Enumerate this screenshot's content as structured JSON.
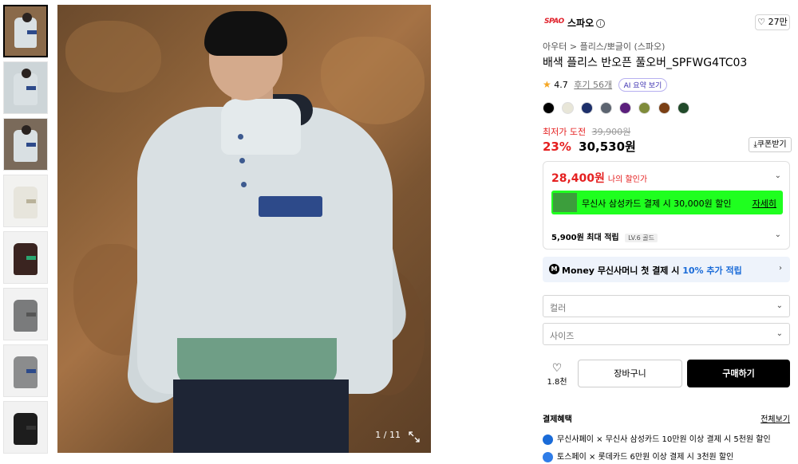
{
  "gallery": {
    "counter": "1 / 11",
    "thumbnails": [
      {
        "bg": "#8a6a4a",
        "garment": "#d9e0e3",
        "pocket": "#2d4a8a"
      },
      {
        "bg": "#cdd5d8",
        "garment": "#d9e0e3",
        "pocket": "#2d4a8a"
      },
      {
        "bg": "#7a6a5a",
        "garment": "#d9e0e3",
        "pocket": "#2d4a8a"
      },
      {
        "bg": "#f2f2f0",
        "garment": "#e7e5dc",
        "pocket": "#b9b29a"
      },
      {
        "bg": "#f2f2f2",
        "garment": "#3a2420",
        "pocket": "#2aa570"
      },
      {
        "bg": "#f2f2f2",
        "garment": "#7a7b7c",
        "pocket": "#555"
      },
      {
        "bg": "#f2f2f2",
        "garment": "#8b8c8d",
        "pocket": "#2d4a8a"
      },
      {
        "bg": "#f2f2f2",
        "garment": "#1d1d1d",
        "pocket": "#333"
      }
    ]
  },
  "brand": {
    "logo": "SPAO",
    "name": "스파오",
    "likes": "27만"
  },
  "breadcrumb": "아우터 > 플리스/뽀글이 (스파오)",
  "title": "배색 플리스 반오픈 풀오버_SPFWG4TC03",
  "rating": {
    "score": "4.7",
    "reviews": "후기 56개",
    "ai_label": "AI 요약 보기"
  },
  "colors": [
    "#000000",
    "#e8e6d8",
    "#1d2f6a",
    "#5c6470",
    "#5b1f7c",
    "#7f8b3a",
    "#7a3f14",
    "#214a2a"
  ],
  "pricing": {
    "deal_label": "최저가 도전",
    "original": "39,900원",
    "discount": "23%",
    "price": "30,530원",
    "coupon": "쿠폰받기",
    "my_price": "28,400원",
    "my_price_label": "나의 할인가",
    "card_offer": "무신사 삼성카드 결제 시 30,000원 할인",
    "card_detail": "자세히",
    "points": "5,900원 최대 적립",
    "level": "LV.6 골드"
  },
  "money": {
    "brand": "Money",
    "text": "무신사머니 첫 결제 시",
    "accent": "10% 추가 적립"
  },
  "options": {
    "color_placeholder": "컬러",
    "size_placeholder": "사이즈"
  },
  "actions": {
    "fav_count": "1.8천",
    "cart": "장바구니",
    "buy": "구매하기"
  },
  "benefits": {
    "heading": "결제혜택",
    "all": "전체보기",
    "items": [
      {
        "text": "무신사페이 × 무신사 삼성카드 10만원 이상 결제 시 5천원 할인",
        "color": "#1a6bd8"
      },
      {
        "text": "토스페이 × 롯데카드 6만원 이상 결제 시 3천원 할인",
        "color": "#2f7de8"
      }
    ]
  }
}
